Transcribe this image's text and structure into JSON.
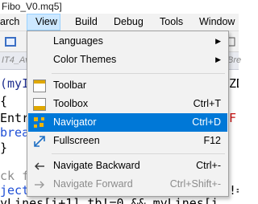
{
  "window": {
    "title_fragment": "Fibo_V0.mq5]"
  },
  "menubar": {
    "items": [
      {
        "label": "arch"
      },
      {
        "label": "View"
      },
      {
        "label": "Build"
      },
      {
        "label": "Debug"
      },
      {
        "label": "Tools"
      },
      {
        "label": "Window"
      }
    ]
  },
  "tabs": {
    "left_fragment": "IT4_Av",
    "right_fragment": "Bre"
  },
  "code": {
    "lines_left": [
      "(myI",
      "{",
      "Entr",
      "brea",
      "}",
      "",
      "ck f",
      "ject",
      "yLines[i+1].tb!=0 && myLines[i"
    ],
    "lines_right": [
      "ZD",
      "",
      "F,",
      "",
      "",
      "",
      "",
      "!=",
      ""
    ]
  },
  "view_menu": {
    "items": [
      {
        "label": "Languages",
        "shortcut": "",
        "submenu": true,
        "icon": ""
      },
      {
        "label": "Color Themes",
        "shortcut": "",
        "submenu": true,
        "icon": ""
      },
      {
        "label": "Toolbar",
        "shortcut": "",
        "submenu": false,
        "icon": "toolbar-icon"
      },
      {
        "label": "Toolbox",
        "shortcut": "Ctrl+T",
        "submenu": false,
        "icon": "toolbox-icon"
      },
      {
        "label": "Navigator",
        "shortcut": "Ctrl+D",
        "submenu": false,
        "icon": "navigator-icon",
        "selected": true
      },
      {
        "label": "Fullscreen",
        "shortcut": "F12",
        "submenu": false,
        "icon": "fullscreen-icon"
      },
      {
        "label": "Navigate Backward",
        "shortcut": "Ctrl+-",
        "submenu": false,
        "icon": "arrow-left-icon"
      },
      {
        "label": "Navigate Forward",
        "shortcut": "Ctrl+Shift+-",
        "submenu": false,
        "icon": "arrow-right-icon",
        "disabled": true
      }
    ]
  },
  "colors": {
    "selection": "#0078d7",
    "menu_active": "#cde8ff",
    "code_purple": "#8b1fa8",
    "code_blue": "#1f4fd6",
    "code_red": "#cc1111"
  }
}
